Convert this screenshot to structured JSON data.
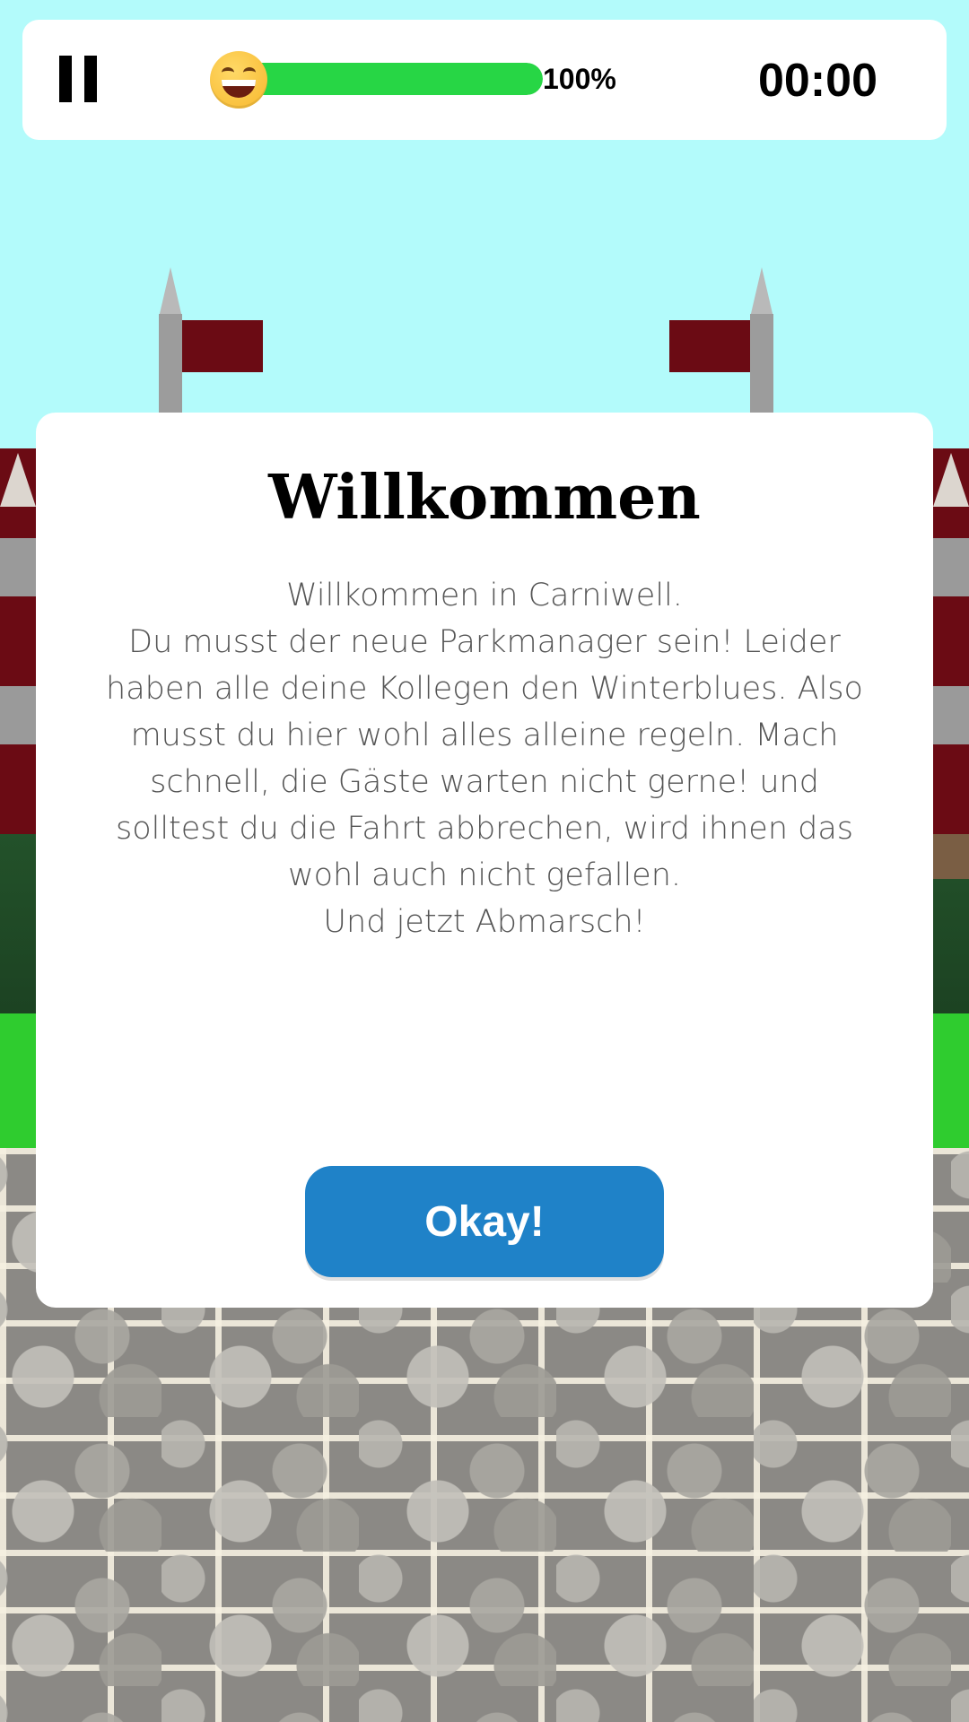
{
  "hud": {
    "pause_icon": "pause-icon",
    "mood_icon": "grinning-face-emoji",
    "progress_value": 1.0,
    "progress_label": "100%",
    "timer": "00:00"
  },
  "dialog": {
    "title": "Willkommen",
    "body_lines": [
      "Willkommen in Carniwell.",
      "Du musst der neue Parkmanager sein! Leider haben alle deine Kollegen den Winterblues. Also musst du hier wohl alles alleine regeln. Mach schnell, die Gäste warten nicht gerne! und solltest du die Fahrt abbrechen, wird ihnen das wohl auch nicht gefallen.",
      "Und jetzt Abmarsch!"
    ],
    "button_label": "Okay!"
  },
  "colors": {
    "sky": "#b3fbfb",
    "progress_fill": "#27d645",
    "button": "#1f82c8",
    "flag": "#6b0b14"
  }
}
